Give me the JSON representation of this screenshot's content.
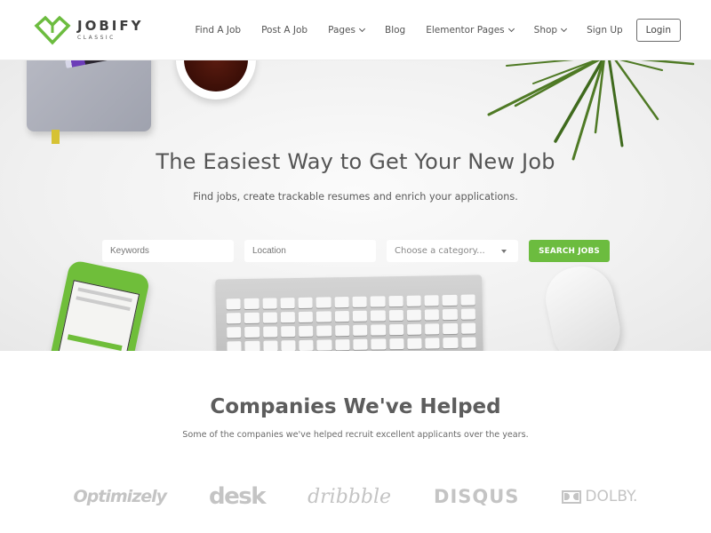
{
  "brand": {
    "name": "JOBIFY",
    "tagline": "CLASSIC",
    "accent_color": "#6cbc3f"
  },
  "nav": {
    "items": [
      {
        "label": "Find A Job",
        "dropdown": false
      },
      {
        "label": "Post A Job",
        "dropdown": false
      },
      {
        "label": "Pages",
        "dropdown": true
      },
      {
        "label": "Blog",
        "dropdown": false
      },
      {
        "label": "Elementor Pages",
        "dropdown": true
      },
      {
        "label": "Shop",
        "dropdown": true
      },
      {
        "label": "Sign Up",
        "dropdown": false
      }
    ],
    "login_label": "Login"
  },
  "hero": {
    "title": "The Easiest Way to Get Your New Job",
    "subtitle": "Find jobs, create trackable resumes and enrich your applications.",
    "search": {
      "keywords_placeholder": "Keywords",
      "location_placeholder": "Location",
      "category_selected": "Choose a category...",
      "button_label": "SEARCH JOBS"
    }
  },
  "companies": {
    "title": "Companies We've Helped",
    "subtitle": "Some of the companies we've helped recruit excellent applicants over the years.",
    "logos": [
      "Optimizely",
      "desk",
      "dribbble",
      "DISQUS",
      "DOLBY."
    ]
  }
}
